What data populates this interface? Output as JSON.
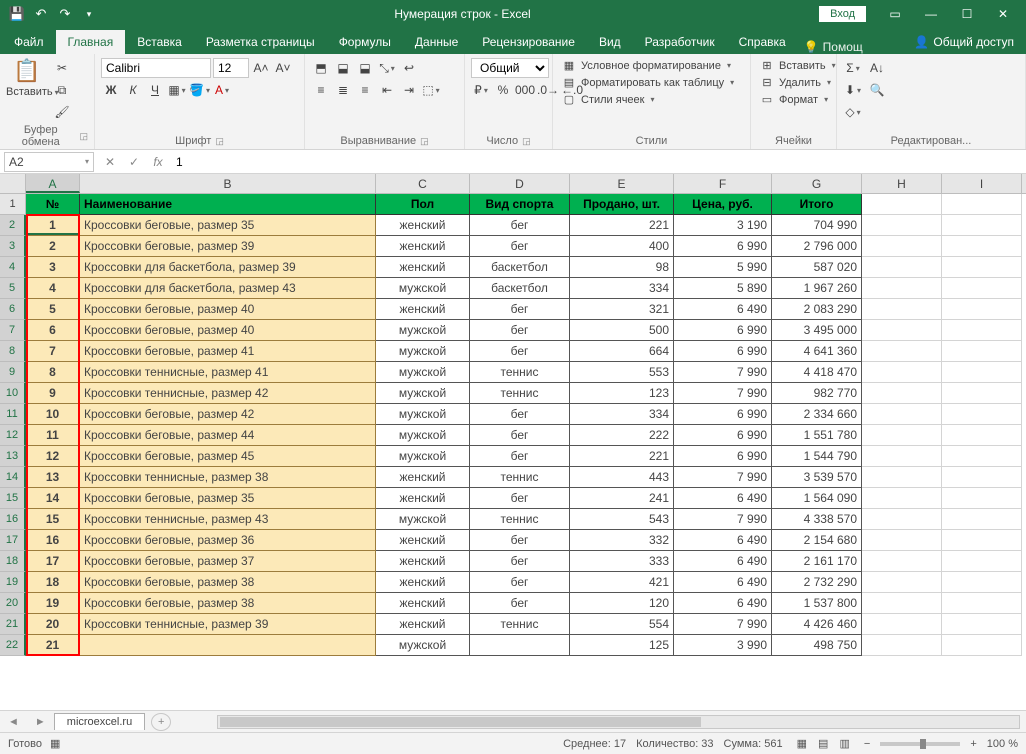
{
  "title": "Нумерация строк - Excel",
  "signin": "Вход",
  "tabs": [
    "Файл",
    "Главная",
    "Вставка",
    "Разметка страницы",
    "Формулы",
    "Данные",
    "Рецензирование",
    "Вид",
    "Разработчик",
    "Справка"
  ],
  "active_tab": 1,
  "tellme": "Помощ",
  "share": "Общий доступ",
  "ribbon": {
    "clipboard": {
      "label": "Буфер обмена",
      "paste": "Вставить"
    },
    "font": {
      "label": "Шрифт",
      "name": "Calibri",
      "size": "12",
      "bold": "Ж",
      "italic": "К",
      "underline": "Ч"
    },
    "alignment": {
      "label": "Выравнивание"
    },
    "number": {
      "label": "Число",
      "format": "Общий"
    },
    "styles": {
      "label": "Стили",
      "cond": "Условное форматирование",
      "table": "Форматировать как таблицу",
      "cell": "Стили ячеек"
    },
    "cells": {
      "label": "Ячейки",
      "insert": "Вставить",
      "delete": "Удалить",
      "format": "Формат"
    },
    "editing": {
      "label": "Редактирован..."
    }
  },
  "namebox": "A2",
  "formula": "1",
  "columns": [
    "A",
    "B",
    "C",
    "D",
    "E",
    "F",
    "G",
    "H",
    "I"
  ],
  "header_row": {
    "num": "№",
    "name": "Наименование",
    "gender": "Пол",
    "sport": "Вид спорта",
    "sold": "Продано, шт.",
    "price": "Цена, руб.",
    "total": "Итого"
  },
  "rows": [
    {
      "n": 1,
      "name": "Кроссовки беговые, размер 35",
      "g": "женский",
      "s": "бег",
      "sold": 221,
      "price": "3 190",
      "total": "704 990"
    },
    {
      "n": 2,
      "name": "Кроссовки беговые, размер 39",
      "g": "женский",
      "s": "бег",
      "sold": 400,
      "price": "6 990",
      "total": "2 796 000"
    },
    {
      "n": 3,
      "name": "Кроссовки для баскетбола, размер 39",
      "g": "женский",
      "s": "баскетбол",
      "sold": 98,
      "price": "5 990",
      "total": "587 020"
    },
    {
      "n": 4,
      "name": "Кроссовки для баскетбола, размер 43",
      "g": "мужской",
      "s": "баскетбол",
      "sold": 334,
      "price": "5 890",
      "total": "1 967 260"
    },
    {
      "n": 5,
      "name": "Кроссовки беговые, размер 40",
      "g": "женский",
      "s": "бег",
      "sold": 321,
      "price": "6 490",
      "total": "2 083 290"
    },
    {
      "n": 6,
      "name": "Кроссовки беговые, размер 40",
      "g": "мужской",
      "s": "бег",
      "sold": 500,
      "price": "6 990",
      "total": "3 495 000"
    },
    {
      "n": 7,
      "name": "Кроссовки беговые, размер 41",
      "g": "мужской",
      "s": "бег",
      "sold": 664,
      "price": "6 990",
      "total": "4 641 360"
    },
    {
      "n": 8,
      "name": "Кроссовки теннисные, размер 41",
      "g": "мужской",
      "s": "теннис",
      "sold": 553,
      "price": "7 990",
      "total": "4 418 470"
    },
    {
      "n": 9,
      "name": "Кроссовки теннисные, размер 42",
      "g": "мужской",
      "s": "теннис",
      "sold": 123,
      "price": "7 990",
      "total": "982 770"
    },
    {
      "n": 10,
      "name": "Кроссовки беговые, размер 42",
      "g": "мужской",
      "s": "бег",
      "sold": 334,
      "price": "6 990",
      "total": "2 334 660"
    },
    {
      "n": 11,
      "name": "Кроссовки беговые, размер 44",
      "g": "мужской",
      "s": "бег",
      "sold": 222,
      "price": "6 990",
      "total": "1 551 780"
    },
    {
      "n": 12,
      "name": "Кроссовки беговые, размер 45",
      "g": "мужской",
      "s": "бег",
      "sold": 221,
      "price": "6 990",
      "total": "1 544 790"
    },
    {
      "n": 13,
      "name": "Кроссовки теннисные, размер 38",
      "g": "женский",
      "s": "теннис",
      "sold": 443,
      "price": "7 990",
      "total": "3 539 570"
    },
    {
      "n": 14,
      "name": "Кроссовки беговые, размер 35",
      "g": "женский",
      "s": "бег",
      "sold": 241,
      "price": "6 490",
      "total": "1 564 090"
    },
    {
      "n": 15,
      "name": "Кроссовки теннисные, размер 43",
      "g": "мужской",
      "s": "теннис",
      "sold": 543,
      "price": "7 990",
      "total": "4 338 570"
    },
    {
      "n": 16,
      "name": "Кроссовки беговые, размер 36",
      "g": "женский",
      "s": "бег",
      "sold": 332,
      "price": "6 490",
      "total": "2 154 680"
    },
    {
      "n": 17,
      "name": "Кроссовки беговые, размер 37",
      "g": "женский",
      "s": "бег",
      "sold": 333,
      "price": "6 490",
      "total": "2 161 170"
    },
    {
      "n": 18,
      "name": "Кроссовки беговые, размер 38",
      "g": "женский",
      "s": "бег",
      "sold": 421,
      "price": "6 490",
      "total": "2 732 290"
    },
    {
      "n": 19,
      "name": "Кроссовки беговые, размер 38",
      "g": "женский",
      "s": "бег",
      "sold": 120,
      "price": "6 490",
      "total": "1 537 800"
    },
    {
      "n": 20,
      "name": "Кроссовки теннисные, размер 39",
      "g": "женский",
      "s": "теннис",
      "sold": 554,
      "price": "7 990",
      "total": "4 426 460"
    },
    {
      "n": 21,
      "name": "",
      "g": "мужской",
      "s": "",
      "sold": 125,
      "price": "3 990",
      "total": "498 750"
    }
  ],
  "sheet": "microexcel.ru",
  "status": {
    "ready": "Готово",
    "avg": "Среднее: 17",
    "count": "Количество: 33",
    "sum": "Сумма: 561",
    "zoom": "100 %"
  }
}
